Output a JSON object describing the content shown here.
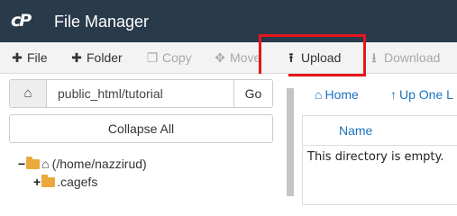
{
  "app": {
    "logo_text": "cP",
    "title": "File Manager"
  },
  "toolbar": {
    "file": {
      "icon": "plus-icon",
      "label": "File"
    },
    "folder": {
      "icon": "plus-icon",
      "label": "Folder"
    },
    "copy": {
      "icon": "copy-icon",
      "label": "Copy"
    },
    "move": {
      "icon": "move-icon",
      "label": "Move"
    },
    "upload": {
      "icon": "upload-icon",
      "label": "Upload"
    },
    "download": {
      "icon": "download-icon",
      "label": "Download"
    }
  },
  "path_bar": {
    "value": "public_html/tutorial",
    "go_label": "Go"
  },
  "collapse_all_label": "Collapse All",
  "tree": {
    "root_label": "(/home/nazzirud)",
    "child_label": ".cagefs"
  },
  "nav": {
    "home_label": "Home",
    "up_label": "Up One L"
  },
  "table": {
    "column_name": "Name",
    "empty_message": "This directory is empty."
  },
  "colors": {
    "header_bg": "#293a4a",
    "link": "#1e73be",
    "highlight": "#e5161b",
    "folder": "#e9a93c"
  }
}
